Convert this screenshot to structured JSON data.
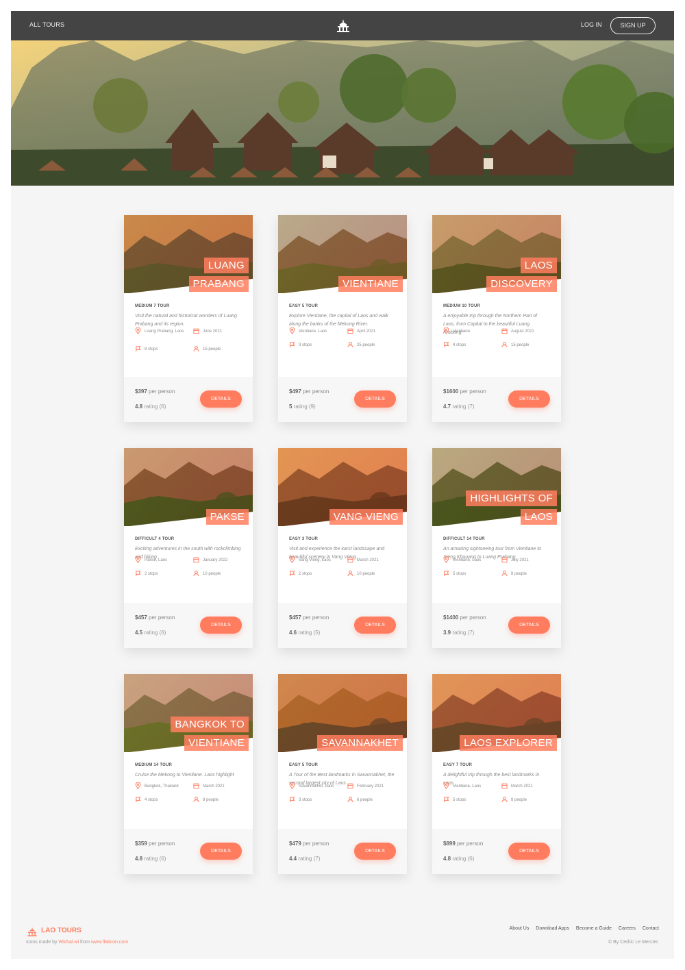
{
  "header": {
    "all_tours": "ALL TOURS",
    "log_in": "LOG IN",
    "sign_up": "SIGN UP",
    "logo_icon": "temple-icon"
  },
  "accent_color": "#ff7c5f",
  "tours": [
    {
      "title_lines": [
        "LUANG",
        "PRABANG"
      ],
      "difficulty": "MEDIUM 7 TOUR",
      "description": "Visit the natural and historical wonders of Luang Prabang and its region.",
      "location": "Luang Prabang, Laos",
      "date": "June 2021",
      "stops": "8 stops",
      "people": "15 people",
      "price": "$397",
      "price_suffix": "per person",
      "rating": "4.8",
      "rating_suffix": "rating (6)",
      "button": "DETAILS"
    },
    {
      "title_lines": [
        "VIENTIANE"
      ],
      "difficulty": "EASY 5 TOUR",
      "description": "Explore Vientiane, the capital of Laos and walk along the banks of the Mekong River.",
      "location": "Vientiane, Laos",
      "date": "April 2021",
      "stops": "3 stops",
      "people": "25 people",
      "price": "$497",
      "price_suffix": "per person",
      "rating": "5",
      "rating_suffix": "rating (9)",
      "button": "DETAILS"
    },
    {
      "title_lines": [
        "LAOS",
        "DISCOVERY"
      ],
      "difficulty": "MEDIUM 10 TOUR",
      "description": "A enjoyable trip through the Northern Part of Laos, from Capital to the beautiful Luang Prabang.",
      "location": "Vientiane",
      "date": "August 2021",
      "stops": "4 stops",
      "people": "15 people",
      "price": "$1600",
      "price_suffix": "per person",
      "rating": "4.7",
      "rating_suffix": "rating (7)",
      "button": "DETAILS"
    },
    {
      "title_lines": [
        "PAKSE"
      ],
      "difficulty": "DIFFICULT 4 TOUR",
      "description": "Exciting adventures in the south with rockclimbing and hiking.",
      "location": "Pakse, Laos",
      "date": "January 2022",
      "stops": "2 stops",
      "people": "10 people",
      "price": "$457",
      "price_suffix": "per person",
      "rating": "4.5",
      "rating_suffix": "rating (6)",
      "button": "DETAILS"
    },
    {
      "title_lines": [
        "VANG VIENG"
      ],
      "difficulty": "EASY 3 TOUR",
      "description": "Visit and experience the karst landscape and beautiful scenery in Vang Vieng.",
      "location": "Vang Vieng, Laos",
      "date": "March 2021",
      "stops": "2 stops",
      "people": "10 people",
      "price": "$457",
      "price_suffix": "per person",
      "rating": "4.6",
      "rating_suffix": "rating (5)",
      "button": "DETAILS"
    },
    {
      "title_lines": [
        "HIGHLIGHTS OF",
        "LAOS"
      ],
      "difficulty": "DIFFICULT 14 TOUR",
      "description": "An amazing sightseeing tour from Vientiane to Xieng Khouang to Luang Prabang",
      "location": "Vientiane, Laos",
      "date": "July 2021",
      "stops": "5 stops",
      "people": "8 people",
      "price": "$1400",
      "price_suffix": "per person",
      "rating": "3.9",
      "rating_suffix": "rating (7)",
      "button": "DETAILS"
    },
    {
      "title_lines": [
        "BANGKOK TO",
        "VIENTIANE"
      ],
      "difficulty": "MEDIUM 14 TOUR",
      "description": "Cruise the Mekong to Vientiane. Laos highlight",
      "location": "Bangkok, Thailand",
      "date": "March 2021",
      "stops": "4 stops",
      "people": "8 people",
      "price": "$359",
      "price_suffix": "per person",
      "rating": "4.8",
      "rating_suffix": "rating (6)",
      "button": "DETAILS"
    },
    {
      "title_lines": [
        "SAVANNAKHET"
      ],
      "difficulty": "EASY 5 TOUR",
      "description": "A Tour of the Best landmarks in Savannakhet, the second largest city of Laos",
      "location": "Savannakhet, Laos",
      "date": "February 2021",
      "stops": "3 stops",
      "people": "6 people",
      "price": "$479",
      "price_suffix": "per person",
      "rating": "4.4",
      "rating_suffix": "rating (7)",
      "button": "DETAILS"
    },
    {
      "title_lines": [
        "LAOS EXPLORER"
      ],
      "difficulty": "EASY 7 TOUR",
      "description": "A delightful trip through the best landmarks in Laos",
      "location": "Vientiane, Laos",
      "date": "March 2021",
      "stops": "5 stops",
      "people": "8 people",
      "price": "$899",
      "price_suffix": "per person",
      "rating": "4.8",
      "rating_suffix": "rating (6)",
      "button": "DETAILS"
    }
  ],
  "footer": {
    "brand": "LAO TOURS",
    "credit_prefix": "Icons made by",
    "credit_author": "Wichai.wi",
    "credit_from": "from",
    "credit_site": "www.flaticon.com",
    "links": [
      "About Us",
      "Download Apps",
      "Become a Guide",
      "Careers",
      "Contact"
    ],
    "copyright": "© By Cedric Le Mercier."
  }
}
